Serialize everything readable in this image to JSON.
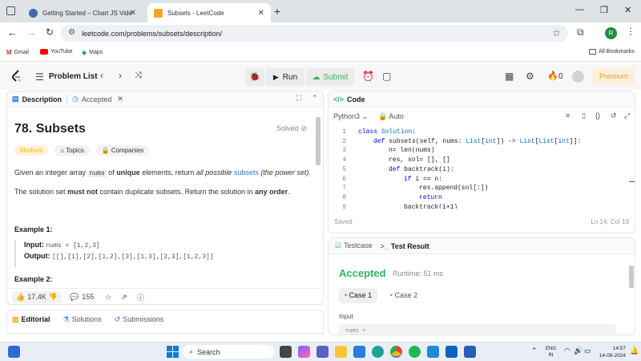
{
  "browser": {
    "tabs": [
      {
        "title": "Getting Started – Chart JS Video Guid",
        "active": false
      },
      {
        "title": "Subsets - LeetCode",
        "active": true
      }
    ],
    "url": "leetcode.com/problems/subsets/description/",
    "avatar_letter": "R",
    "bookmarks": [
      "Gmail",
      "YouTube",
      "Maps"
    ],
    "all_bookmarks": "All Bookmarks"
  },
  "leetcode": {
    "problem_list": "Problem List",
    "run": "Run",
    "submit": "Submit",
    "streak": "0",
    "premium": "Premium"
  },
  "left": {
    "tabs": {
      "description": "Description",
      "accepted": "Accepted"
    },
    "title": "78. Subsets",
    "solved": "Solved",
    "tags": [
      "Medium",
      "Topics",
      "Companies"
    ],
    "desc": {
      "p1a": "Given an integer array ",
      "p1code": "nums",
      "p1b": " of ",
      "p1bold": "unique",
      "p1c": " elements, return ",
      "p1em": "all possible",
      "p1link": "subsets",
      "p1d": " (the power set).",
      "p2a": "The solution set ",
      "p2bold": "must not",
      "p2b": " contain duplicate subsets. Return the solution in ",
      "p2bold2": "any order",
      "p2c": "."
    },
    "example1": {
      "heading": "Example 1:",
      "input_label": "Input:",
      "input": "nums = [1,2,3]",
      "output_label": "Output:",
      "output": "[[],[1],[2],[1,2],[3],[1,3],[2,3],[1,2,3]]"
    },
    "example2_heading": "Example 2:",
    "likes": "17.4K",
    "comments": "155",
    "bottom_tabs": [
      "Editorial",
      "Solutions",
      "Submissions"
    ]
  },
  "code": {
    "tab": "Code",
    "language": "Python3",
    "mode": "Auto",
    "lines": [
      {
        "n": "1",
        "indent": 0,
        "parts": [
          [
            "kw",
            "class "
          ],
          [
            "ty",
            "Solution"
          ],
          [
            "txt",
            ":"
          ]
        ]
      },
      {
        "n": "2",
        "indent": 1,
        "parts": [
          [
            "kw",
            "def "
          ],
          [
            "txt",
            "subsets(self, nums: "
          ],
          [
            "ty",
            "List"
          ],
          [
            "txt",
            "["
          ],
          [
            "ty",
            "int"
          ],
          [
            "txt",
            "]) -> "
          ],
          [
            "ty",
            "List"
          ],
          [
            "txt",
            "["
          ],
          [
            "ty",
            "List"
          ],
          [
            "txt",
            "["
          ],
          [
            "ty",
            "int"
          ],
          [
            "txt",
            "]]:"
          ]
        ]
      },
      {
        "n": "3",
        "indent": 2,
        "parts": [
          [
            "txt",
            "n= len(nums)"
          ]
        ]
      },
      {
        "n": "4",
        "indent": 2,
        "parts": [
          [
            "txt",
            "res, sol= [], []"
          ]
        ]
      },
      {
        "n": "5",
        "indent": 2,
        "parts": [
          [
            "kw",
            "def "
          ],
          [
            "txt",
            "backtrack(i):"
          ]
        ]
      },
      {
        "n": "6",
        "indent": 3,
        "parts": [
          [
            "kw",
            "if "
          ],
          [
            "txt",
            "i == n:"
          ]
        ]
      },
      {
        "n": "7",
        "indent": 4,
        "parts": [
          [
            "txt",
            "res.append(sol[:])"
          ]
        ]
      },
      {
        "n": "8",
        "indent": 4,
        "parts": [
          [
            "kw",
            "return"
          ]
        ]
      },
      {
        "n": "9",
        "indent": 3,
        "parts": [
          [
            "txt",
            "backtrack(i+1)"
          ]
        ]
      }
    ],
    "status": "Saved",
    "cursor": "Ln 14, Col 19"
  },
  "test": {
    "tabs": [
      "Testcase",
      "Test Result"
    ],
    "result": "Accepted",
    "runtime": "Runtime: 51 ms",
    "cases": [
      "Case 1",
      "Case 2"
    ],
    "input_label": "Input",
    "input_preview": "nums ="
  },
  "taskbar": {
    "search": "Search",
    "lang1": "ENG",
    "lang2": "IN",
    "time": "14:57",
    "date": "14-09-2024"
  }
}
